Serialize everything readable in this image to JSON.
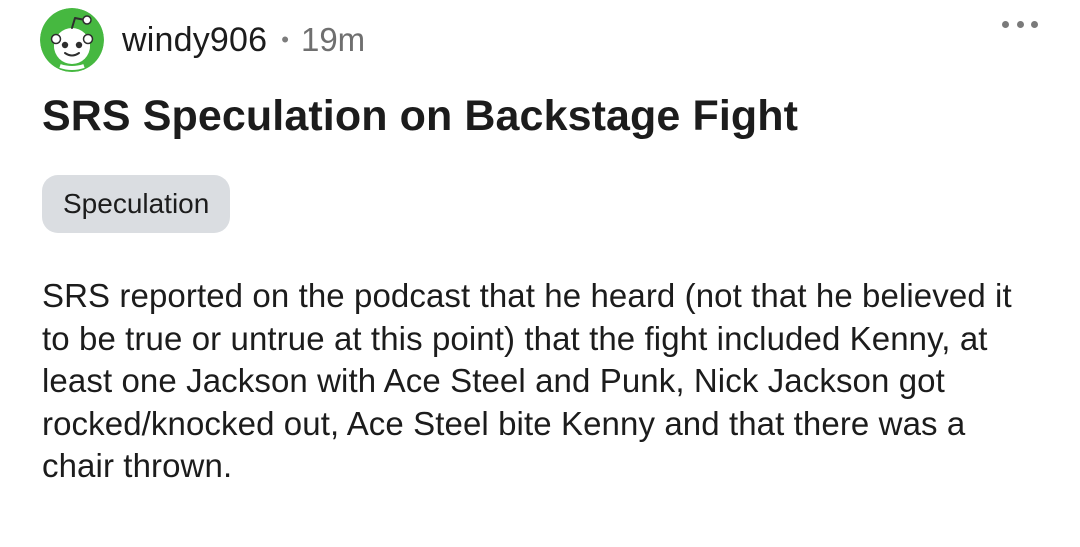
{
  "post": {
    "author": "windy906",
    "separator": "•",
    "timestamp": "19m",
    "title": "SRS Speculation on Backstage Fight",
    "flair": "Speculation",
    "body": "SRS reported on the podcast that he heard (not that he believed it to be true or untrue at this point) that the fight included Kenny, at least one Jackson with Ace Steel and Punk, Nick Jackson got rocked/knocked out, Ace Steel bite Kenny and that there was a chair thrown."
  },
  "icons": {
    "avatar": "snoo-avatar-icon",
    "menu": "more-options-icon"
  },
  "colors": {
    "avatar_background": "#46b840",
    "flair_background": "#dadde1",
    "text": "#1c1c1c",
    "meta_text": "#6f6f6f"
  }
}
